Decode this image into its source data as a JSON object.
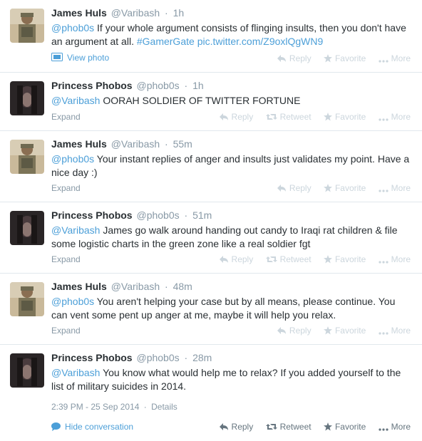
{
  "tweets": [
    {
      "fullname": "James Huls",
      "username": "@Varibash",
      "dot": "·",
      "time": "1h",
      "text_parts": [
        "@phob0s",
        " If your whole argument consists of flinging insults, then you don't have an argument at all. ",
        "#GamerGate",
        " ",
        "pic.twitter.com/Z9oxlQgWN9"
      ],
      "footer_link": "View photo",
      "actions": [
        "Reply",
        "Favorite",
        "More"
      ]
    },
    {
      "fullname": "Princess Phobos",
      "username": "@phob0s",
      "dot": "·",
      "time": "1h",
      "text_parts": [
        "@Varibash",
        " OORAH SOLDIER OF TWITTER FORTUNE"
      ],
      "footer_link": "Expand",
      "actions": [
        "Reply",
        "Retweet",
        "Favorite",
        "More"
      ]
    },
    {
      "fullname": "James Huls",
      "username": "@Varibash",
      "dot": "·",
      "time": "55m",
      "text_parts": [
        "@phob0s",
        " Your instant replies of anger and insults just validates my point. Have a nice day :)"
      ],
      "footer_link": "Expand",
      "actions": [
        "Reply",
        "Favorite",
        "More"
      ]
    },
    {
      "fullname": "Princess Phobos",
      "username": "@phob0s",
      "dot": "·",
      "time": "51m",
      "text_parts": [
        "@Varibash",
        " James go walk around handing out candy to Iraqi rat children & file some logistic charts in the green zone like a real soldier fgt"
      ],
      "footer_link": "Expand",
      "actions": [
        "Reply",
        "Retweet",
        "Favorite",
        "More"
      ]
    },
    {
      "fullname": "James Huls",
      "username": "@Varibash",
      "dot": "·",
      "time": "48m",
      "text_parts": [
        "@phob0s",
        " You aren't helping your case but by all means, please continue. You can vent some pent up anger at me, maybe it will help you relax."
      ],
      "footer_link": "Expand",
      "actions": [
        "Reply",
        "Favorite",
        "More"
      ]
    },
    {
      "fullname": "Princess Phobos",
      "username": "@phob0s",
      "dot": "·",
      "time": "28m",
      "text_parts": [
        "@Varibash",
        " You know what would help me to relax? If you added yourself to the list of military suicides in 2014."
      ],
      "datetime": "2:39 PM - 25 Sep 2014",
      "datetime_sep": "·",
      "details": "Details",
      "footer_link": "Hide conversation",
      "actions": [
        "Reply",
        "Retweet",
        "Favorite",
        "More"
      ]
    }
  ],
  "colors": {
    "link": "#4c9fd8",
    "muted": "#8899a6",
    "action_faded": "#ccd6dd",
    "action_active": "#66757f",
    "border": "#e1e8ed"
  },
  "icons": {
    "reply": "reply-icon",
    "retweet": "retweet-icon",
    "favorite": "star-icon",
    "more": "more-dots-icon",
    "photo": "photo-icon",
    "conversation": "speech-bubble-icon"
  }
}
